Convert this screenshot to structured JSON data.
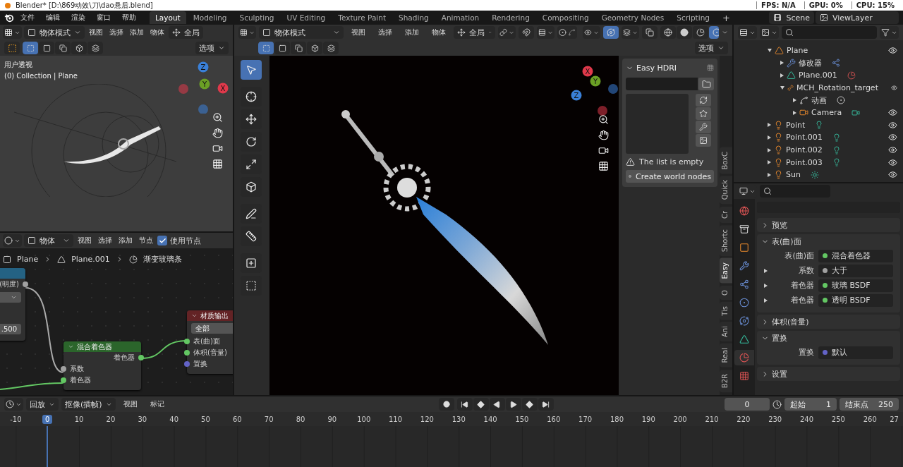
{
  "title_bar": {
    "title": "Blender* [D:\\869动效\\刀\\dao悬后.blend]",
    "stats": [
      "FPS: N/A",
      "GPU: 0%",
      "CPU: 15%"
    ]
  },
  "menus": [
    "文件",
    "编辑",
    "渲染",
    "窗口",
    "帮助"
  ],
  "workspaces": [
    {
      "label": "Layout",
      "selected": true
    },
    {
      "label": "Modeling",
      "selected": false
    },
    {
      "label": "Sculpting",
      "selected": false
    },
    {
      "label": "UV Editing",
      "selected": false
    },
    {
      "label": "Texture Paint",
      "selected": false
    },
    {
      "label": "Shading",
      "selected": false
    },
    {
      "label": "Animation",
      "selected": false
    },
    {
      "label": "Rendering",
      "selected": false
    },
    {
      "label": "Compositing",
      "selected": false
    },
    {
      "label": "Geometry Nodes",
      "selected": false
    },
    {
      "label": "Scripting",
      "selected": false
    }
  ],
  "add_workspace": "+",
  "scene": "Scene",
  "view_layer": "ViewLayer",
  "left_viewport": {
    "mode": "物体模式",
    "menus": [
      "视图",
      "选择",
      "添加",
      "物体"
    ],
    "orientation": "全局",
    "options": "选项",
    "view_name": "用户透视",
    "collection": "(0) Collection | Plane",
    "axes": [
      "X",
      "Y",
      "Z"
    ]
  },
  "node_editor": {
    "type": "物体",
    "menus": [
      "视图",
      "选择",
      "添加",
      "节点"
    ],
    "use_nodes": {
      "label": "使用节点",
      "checked": true
    },
    "breadcrumb": [
      "Plane",
      "Plane.001",
      "渐变玻璃条"
    ],
    "nodes": [
      {
        "kind": "value",
        "outputs": [
          {
            "label": "(明度)",
            "color": "#a1a1a1"
          }
        ],
        "field": ".500"
      },
      {
        "kind": "shader",
        "title": "混合着色器",
        "outputs": [
          {
            "label": "着色器",
            "color": "#63c763"
          }
        ],
        "inputs": [
          {
            "label": "系数",
            "color": "#a1a1a1"
          },
          {
            "label": "着色器",
            "color": "#63c763"
          }
        ]
      },
      {
        "kind": "output",
        "title": "材质输出",
        "choice": "全部",
        "inputs": [
          {
            "label": "表(曲)面",
            "color": "#63c763"
          },
          {
            "label": "体积(音量)",
            "color": "#63c763"
          },
          {
            "label": "置换",
            "color": "#6363c7"
          }
        ]
      }
    ]
  },
  "main_viewport": {
    "mode": "物体模式",
    "menus": [
      "视图",
      "选择",
      "添加",
      "物体"
    ],
    "orientation": "全局",
    "options": "选项",
    "axes": [
      "X",
      "Y",
      "Z"
    ],
    "tools": [
      {
        "kind": "select",
        "selected": true
      },
      {
        "kind": "cursor",
        "selected": false
      },
      {
        "kind": "move",
        "selected": false
      },
      {
        "kind": "rotate",
        "selected": false
      },
      {
        "kind": "scale",
        "selected": false
      },
      {
        "kind": "transform",
        "selected": false
      },
      {
        "kind": "annotate",
        "selected": false
      },
      {
        "kind": "measure",
        "selected": false
      },
      {
        "kind": "add",
        "selected": false
      },
      {
        "kind": "cage",
        "selected": false
      }
    ],
    "hdri": {
      "title": "Easy HDRI",
      "message": "The list is empty",
      "button": "Create world nodes"
    },
    "side_tabs": [
      {
        "label": "BoxC",
        "selected": false
      },
      {
        "label": "Quick",
        "selected": false
      },
      {
        "label": "Cr",
        "selected": false
      },
      {
        "label": "Shortc",
        "selected": false
      },
      {
        "label": "Easy",
        "selected": true
      },
      {
        "label": "O",
        "selected": false
      },
      {
        "label": "Tis",
        "selected": false
      },
      {
        "label": "Ani",
        "selected": false
      },
      {
        "label": "Real",
        "selected": false
      },
      {
        "label": "B2R",
        "selected": false
      }
    ]
  },
  "outliner": {
    "items": [
      {
        "label": "Plane",
        "kind": "mesh",
        "expanded": true,
        "children": [
          {
            "label": "修改器",
            "kind": "modifier",
            "expanded": false
          },
          {
            "label": "Plane.001",
            "kind": "data",
            "expanded": false
          },
          {
            "label": "MCH_Rotation_target",
            "kind": "armature",
            "expanded": true,
            "children": [
              {
                "label": "动画",
                "kind": "action",
                "expanded": false
              },
              {
                "label": "Camera",
                "kind": "camera",
                "expanded": false
              }
            ]
          }
        ]
      },
      {
        "label": "Point",
        "kind": "light",
        "expanded": false
      },
      {
        "label": "Point.001",
        "kind": "light",
        "expanded": false
      },
      {
        "label": "Point.002",
        "kind": "light",
        "expanded": false
      },
      {
        "label": "Point.003",
        "kind": "light",
        "expanded": false
      },
      {
        "label": "Sun",
        "kind": "sun",
        "expanded": false
      }
    ]
  },
  "properties": {
    "tabs": [
      {
        "kind": "world",
        "selected": false
      },
      {
        "kind": "collection",
        "selected": false
      },
      {
        "kind": "object",
        "selected": false
      },
      {
        "kind": "modifier",
        "selected": false
      },
      {
        "kind": "particles",
        "selected": false
      },
      {
        "kind": "physics",
        "selected": false
      },
      {
        "kind": "constraints",
        "selected": false
      },
      {
        "kind": "data",
        "selected": false
      },
      {
        "kind": "material",
        "selected": true
      },
      {
        "kind": "texture",
        "selected": false
      }
    ],
    "panels": [
      {
        "title": "预览",
        "expanded": false
      },
      {
        "title": "表(曲)面",
        "expanded": true,
        "rows": [
          {
            "label": "表(曲)面",
            "value": "混合着色器",
            "color": "#63c763",
            "expandable": false
          },
          {
            "label": "系数",
            "value": "大于",
            "color": "#a1a1a1",
            "expandable": true
          },
          {
            "label": "着色器",
            "value": "玻璃 BSDF",
            "color": "#63c763",
            "expandable": true
          },
          {
            "label": "着色器",
            "value": "透明 BSDF",
            "color": "#63c763",
            "expandable": true
          }
        ]
      },
      {
        "title": "体积(音量)",
        "expanded": false
      },
      {
        "title": "置换",
        "expanded": true,
        "rows": [
          {
            "label": "置换",
            "value": "默认",
            "color": "#6363c7",
            "expandable": false
          }
        ]
      },
      {
        "title": "设置",
        "expanded": false
      }
    ]
  },
  "timeline": {
    "menus": [
      "回放",
      "抠像(插帧)"
    ],
    "items": [
      "视图",
      "标记"
    ],
    "current_frame": "0",
    "start_label": "起始",
    "start": "1",
    "end_label": "结束点",
    "end": "250",
    "ruler": [
      {
        "label": "-10",
        "selected": false
      },
      {
        "label": "0",
        "selected": true
      },
      {
        "label": "10",
        "selected": false
      },
      {
        "label": "20",
        "selected": false
      },
      {
        "label": "30",
        "selected": false
      },
      {
        "label": "40",
        "selected": false
      },
      {
        "label": "50",
        "selected": false
      },
      {
        "label": "60",
        "selected": false
      },
      {
        "label": "70",
        "selected": false
      },
      {
        "label": "80",
        "selected": false
      },
      {
        "label": "90",
        "selected": false
      },
      {
        "label": "100",
        "selected": false
      },
      {
        "label": "110",
        "selected": false
      },
      {
        "label": "120",
        "selected": false
      },
      {
        "label": "130",
        "selected": false
      },
      {
        "label": "140",
        "selected": false
      },
      {
        "label": "150",
        "selected": false
      },
      {
        "label": "160",
        "selected": false
      },
      {
        "label": "170",
        "selected": false
      },
      {
        "label": "180",
        "selected": false
      },
      {
        "label": "190",
        "selected": false
      },
      {
        "label": "200",
        "selected": false
      },
      {
        "label": "210",
        "selected": false
      },
      {
        "label": "220",
        "selected": false
      },
      {
        "label": "230",
        "selected": false
      },
      {
        "label": "240",
        "selected": false
      },
      {
        "label": "250",
        "selected": false
      },
      {
        "label": "260",
        "selected": false
      },
      {
        "label": "27",
        "selected": false
      }
    ]
  }
}
